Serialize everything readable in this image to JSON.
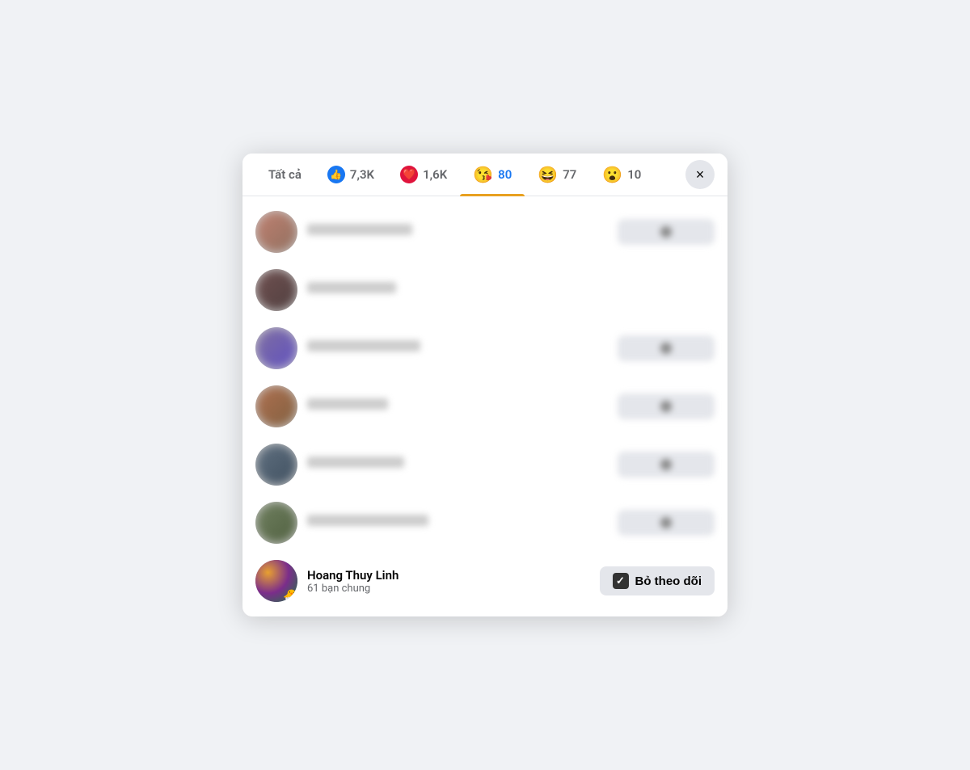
{
  "tabs": [
    {
      "id": "all",
      "label": "Tất cả",
      "icon": "none",
      "count": "",
      "active": false
    },
    {
      "id": "like",
      "label": "7,3K",
      "icon": "like",
      "count": "7,3K",
      "active": false
    },
    {
      "id": "love",
      "label": "1,6K",
      "icon": "love",
      "count": "1,6K",
      "active": false
    },
    {
      "id": "kiss",
      "label": "80",
      "icon": "😘",
      "count": "80",
      "active": true
    },
    {
      "id": "laugh",
      "label": "77",
      "icon": "😆",
      "count": "77",
      "active": false
    },
    {
      "id": "wow",
      "label": "10",
      "icon": "😮",
      "count": "10",
      "active": false
    }
  ],
  "close_label": "×",
  "users_blurred": [
    {
      "id": 1,
      "has_action": true
    },
    {
      "id": 2,
      "has_action": false
    },
    {
      "id": 3,
      "has_action": true
    },
    {
      "id": 4,
      "has_action": true
    },
    {
      "id": 5,
      "has_action": true
    },
    {
      "id": 6,
      "has_action": true
    }
  ],
  "featured_user": {
    "name": "Hoang Thuy Linh",
    "mutual_friends": "61 bạn chung",
    "action_label": "Bỏ theo dõi",
    "check_symbol": "✓"
  }
}
